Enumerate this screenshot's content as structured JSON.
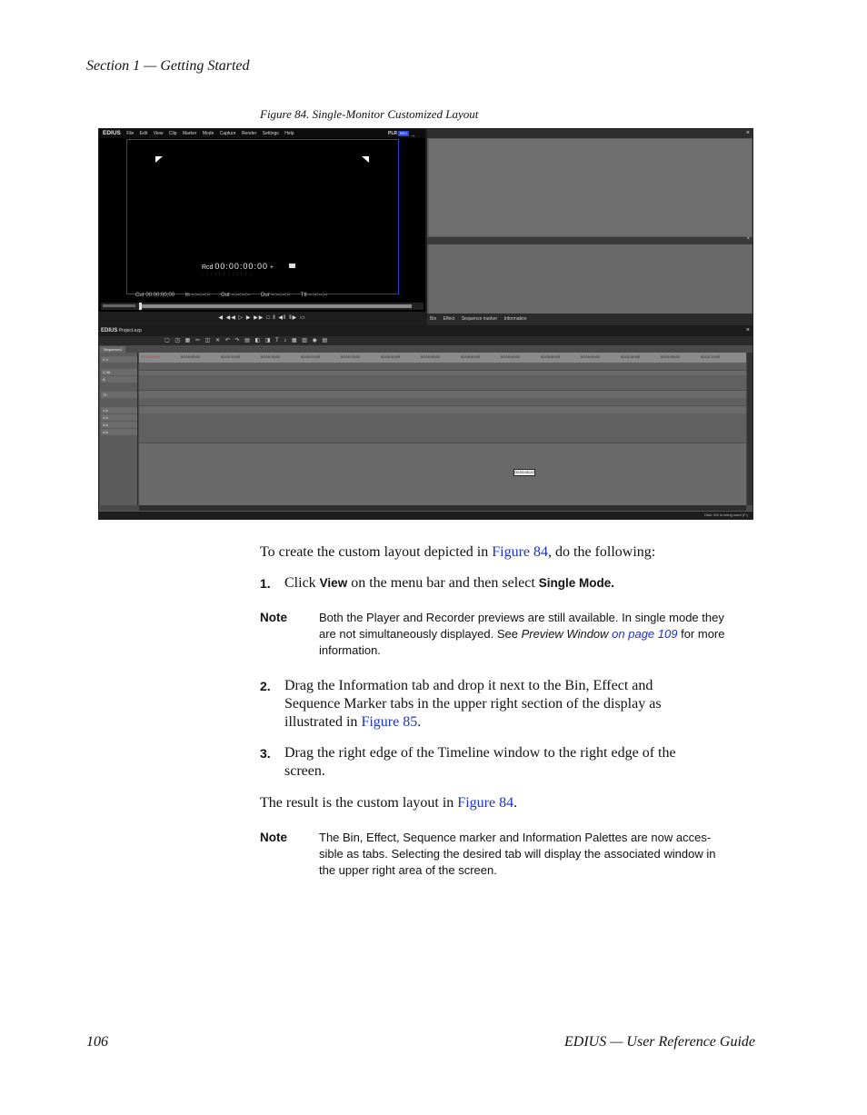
{
  "header": {
    "section": "Section 1 — Getting Started"
  },
  "figure": {
    "caption": "Figure 84.  Single-Monitor Customized Layout",
    "screenshot": {
      "menubar": {
        "logo": "EDIUS",
        "items": [
          "File",
          "Edit",
          "View",
          "Clip",
          "Marker",
          "Mode",
          "Capture",
          "Render",
          "Settings",
          "Help"
        ],
        "plr": "PLR",
        "rec": "REC",
        "min": "_"
      },
      "player": {
        "rec_label": "Rcd",
        "timecode": "00:00:00:00",
        "plus": "+",
        "dots": ": : : : : : : : : : : :",
        "cur": "Cur 00:00:00;00",
        "in": "In --:--:--:--",
        "out": "Out --:--:--:--",
        "dur": "Dur --:--:--:--",
        "ttl": "Ttl --:--:--:--",
        "transport": "◀ ◀◀ ▷ ▶ ▶▶ □ ‖ ◀‖ ‖▶ ▭"
      },
      "right_pane": {
        "close": "×",
        "tabs": [
          "Bin",
          "Effect",
          "Sequence marker",
          "Information"
        ]
      },
      "timeline": {
        "logo": "EDIUS",
        "project": "Project.ezp",
        "close": "×",
        "toolbar": "▢ ◳ ▦ ✂ ◫ ✕ ↶ ↷ ▤ ◧ ◨ T ♪ ▦ ▥ ◉ ▤",
        "sequence_tab": "Sequence1",
        "ruler_ticks": [
          "00:00:00;00",
          "00:00:05;00",
          "00:00:10;00",
          "00:00:15;00",
          "00:00:20;00",
          "00:00:25;00",
          "00:00:30;00",
          "00:00:35;00",
          "00:00:40;00",
          "00:00:45;00",
          "00:00:50;00",
          "00:00:55;00",
          "00:01:00;00",
          "00:01:05;00",
          "00:01:10;00"
        ],
        "track_labels": [
          "2 V",
          "1 VA",
          "A",
          "T1",
          "1 A",
          "2 A",
          "3 A",
          "4 A"
        ],
        "cursor_timecode": "00:00:45;22",
        "status": "Disk: 5% is being used (F:)"
      }
    }
  },
  "body": {
    "intro_before": "To create the custom layout depicted in ",
    "intro_link": "Figure 84",
    "intro_after": ", do the following:",
    "steps": [
      {
        "num": "1.",
        "parts": [
          "Click ",
          "View",
          " on the menu bar and then select ",
          "Single Mode."
        ]
      },
      {
        "num": "2.",
        "line1": "Drag the Information tab and drop it next to the Bin, Effect and",
        "line2": "Sequence Marker tabs in the upper right section of the display as",
        "line3_before": "illustrated in ",
        "line3_link": "Figure 85",
        "line3_after": "."
      },
      {
        "num": "3.",
        "line1": "Drag the right edge of the Timeline window to the right edge of the",
        "line2": "screen."
      }
    ],
    "note1": {
      "label": "Note",
      "line1": "Both the Player and Recorder previews are still available. In single mode they",
      "line2_before": "are not simultaneously displayed. See ",
      "line2_italic": "Preview Window",
      "line2_link": " on page 109",
      "line2_after": " for more",
      "line3": "information."
    },
    "result_before": "The result is the custom layout in ",
    "result_link": "Figure 84",
    "result_after": ".",
    "note2": {
      "label": "Note",
      "line1": "The Bin, Effect, Sequence marker and Information Palettes are now acces-",
      "line2": "sible as tabs. Selecting the desired tab will display the associated window in",
      "line3": "the upper right area of the screen."
    }
  },
  "footer": {
    "page_number": "106",
    "title": "EDIUS  —  User Reference Guide"
  }
}
